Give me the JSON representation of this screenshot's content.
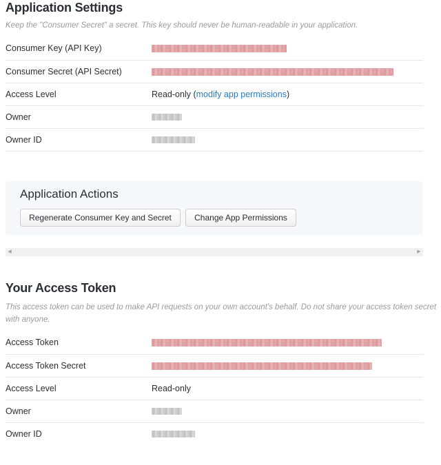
{
  "app_settings": {
    "title": "Application Settings",
    "description": "Keep the \"Consumer Secret\" a secret. This key should never be human-readable in your application.",
    "rows": [
      {
        "label": "Consumer Key (API Key)",
        "value_state": "redacted"
      },
      {
        "label": "Consumer Secret (API Secret)",
        "value_state": "redacted"
      },
      {
        "label": "Access Level",
        "value": "Read-only",
        "link_text": "modify app permissions"
      },
      {
        "label": "Owner",
        "value_state": "redacted"
      },
      {
        "label": "Owner ID",
        "value_state": "redacted"
      }
    ]
  },
  "app_actions": {
    "title": "Application Actions",
    "regenerate_button": "Regenerate Consumer Key and Secret",
    "change_permissions_button": "Change App Permissions"
  },
  "scrollbar": {
    "left_arrow": "◀",
    "right_arrow": "▶"
  },
  "access_token": {
    "title": "Your Access Token",
    "description": "This access token can be used to make API requests on your own account's behalf. Do not share your access token secret with anyone.",
    "rows": [
      {
        "label": "Access Token",
        "value_state": "redacted"
      },
      {
        "label": "Access Token Secret",
        "value_state": "redacted"
      },
      {
        "label": "Access Level",
        "value": "Read-only"
      },
      {
        "label": "Owner",
        "value_state": "redacted"
      },
      {
        "label": "Owner ID",
        "value_state": "redacted"
      }
    ]
  },
  "colors": {
    "link": "#2b7bb9",
    "text": "#292f33",
    "muted": "#9b9b9b",
    "panel_bg": "#f5f8fa",
    "redact_pink": "#e3a2a5"
  }
}
